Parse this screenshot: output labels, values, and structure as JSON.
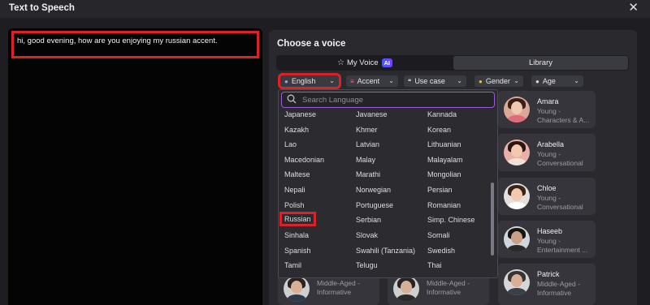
{
  "window": {
    "title": "Text to Speech",
    "close_glyph": "✕"
  },
  "editor": {
    "text": "hi, good evening, how are you enjoying my russian accent."
  },
  "voice_panel": {
    "heading": "Choose a voice",
    "tabs": {
      "my_voice": "My Voice",
      "ai_badge": "AI",
      "library": "Library",
      "active": "Library"
    },
    "filters": {
      "language": "English",
      "accent": "Accent",
      "use_case": "Use case",
      "gender": "Gender",
      "age": "Age"
    },
    "cards": [
      {
        "name": "Amara",
        "desc": "Young - Characters & A..."
      },
      {
        "name": "Arabella",
        "desc": "Young - Conversational"
      },
      {
        "name": "Chloe",
        "desc": "Young - Conversational"
      },
      {
        "name": "Haseeb",
        "desc": "Young - Entertainment ..."
      },
      {
        "name": "Patrick",
        "desc": "Middle-Aged - Informative"
      }
    ],
    "bottom_cards": [
      {
        "desc": "Middle-Aged - Informative"
      },
      {
        "desc": "Middle-Aged - Informative"
      }
    ]
  },
  "language_dropdown": {
    "search_placeholder": "Search Language",
    "rows": [
      [
        "Japanese",
        "Javanese",
        "Kannada"
      ],
      [
        "Kazakh",
        "Khmer",
        "Korean"
      ],
      [
        "Lao",
        "Latvian",
        "Lithuanian"
      ],
      [
        "Macedonian",
        "Malay",
        "Malayalam"
      ],
      [
        "Maltese",
        "Marathi",
        "Mongolian"
      ],
      [
        "Nepali",
        "Norwegian",
        "Persian"
      ],
      [
        "Polish",
        "Portuguese",
        "Romanian"
      ],
      [
        "Russian",
        "Serbian",
        "Simp. Chinese"
      ],
      [
        "Sinhala",
        "Slovak",
        "Somali"
      ],
      [
        "Spanish",
        "Swahili (Tanzania)",
        "Swedish"
      ],
      [
        "Tamil",
        "Telugu",
        "Thai"
      ]
    ],
    "highlighted": "Russian"
  },
  "colors": {
    "highlight": "#d8232a",
    "search_border": "#9a5bd6",
    "accent_badge": "#5b4bff"
  }
}
